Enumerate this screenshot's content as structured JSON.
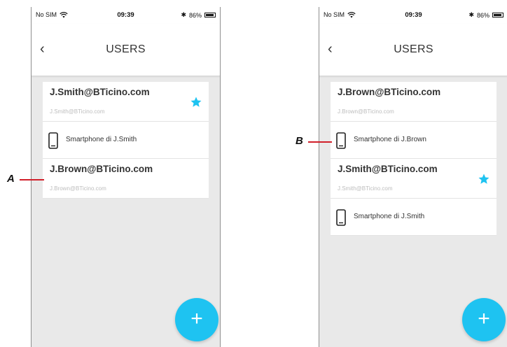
{
  "status_bar": {
    "carrier": "No SIM",
    "time": "09:39",
    "battery": "86%"
  },
  "header": {
    "back_label": "‹",
    "title": "USERS"
  },
  "left_screen": {
    "user_1": {
      "name": "J.Smith@BTicino.com",
      "email": "J.Smith@BTicino.com",
      "favorite": true,
      "device": "Smartphone di J.Smith"
    },
    "user_2": {
      "name": "J.Brown@BTicino.com",
      "email": "J.Brown@BTicino.com",
      "favorite": false
    }
  },
  "right_screen": {
    "user_1": {
      "name": "J.Brown@BTicino.com",
      "email": "J.Brown@BTicino.com",
      "favorite": false,
      "device": "Smartphone di J.Brown"
    },
    "user_2": {
      "name": "J.Smith@BTicino.com",
      "email": "J.Smith@BTicino.com",
      "favorite": true,
      "device": "Smartphone di J.Smith"
    }
  },
  "fab_label": "+",
  "callouts": {
    "a": "A",
    "b": "B"
  },
  "colors": {
    "accent": "#1ec3f1",
    "callout_line": "#d11f2a",
    "screen_bg": "#e9e9e9"
  }
}
